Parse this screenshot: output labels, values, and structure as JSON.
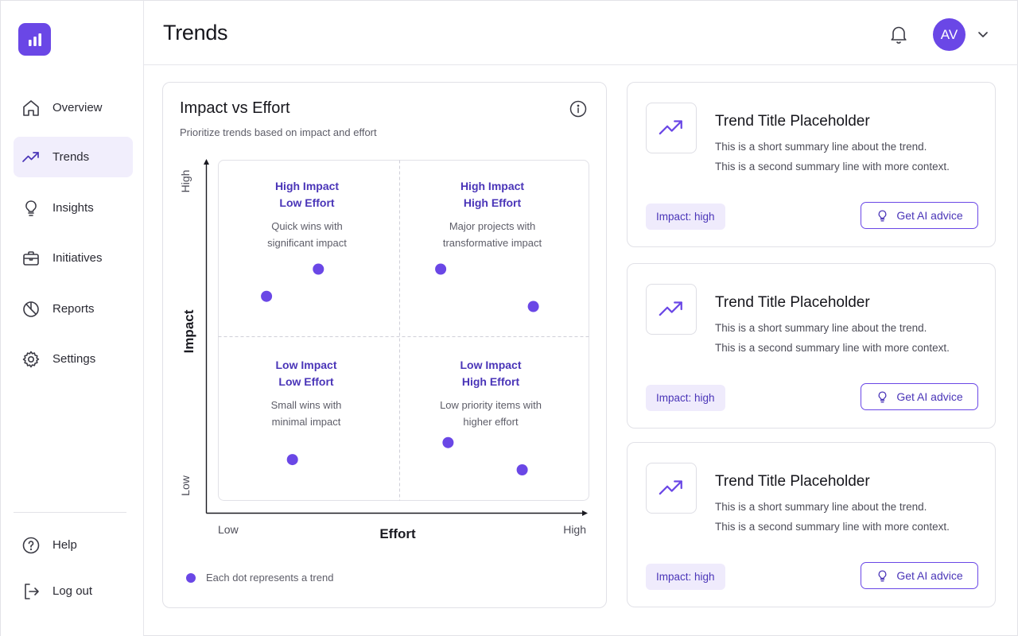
{
  "colors": {
    "accent": "#6a47e6",
    "accent_text": "#4a35b8",
    "active_bg": "#f1eefc"
  },
  "header": {
    "title": "Trends",
    "avatar_initials": "AV"
  },
  "sidebar": {
    "items": [
      {
        "label": "Overview",
        "icon": "home-icon",
        "active": false
      },
      {
        "label": "Trends",
        "icon": "trend-up-icon",
        "active": true
      },
      {
        "label": "Insights",
        "icon": "lightbulb-icon",
        "active": false
      },
      {
        "label": "Initiatives",
        "icon": "briefcase-icon",
        "active": false
      },
      {
        "label": "Reports",
        "icon": "pie-chart-icon",
        "active": false
      },
      {
        "label": "Settings",
        "icon": "gear-icon",
        "active": false
      }
    ],
    "bottom_items": [
      {
        "label": "Help",
        "icon": "help-circle-icon"
      },
      {
        "label": "Log out",
        "icon": "logout-icon"
      }
    ]
  },
  "matrix": {
    "title": "Impact vs Effort",
    "subtitle": "Prioritize trends based on impact and effort",
    "legend": "Each dot represents a trend"
  },
  "chart_data": {
    "type": "scatter",
    "title": "Impact vs Effort",
    "xlabel": "Effort",
    "ylabel": "Impact",
    "x_tick_labels": [
      "Low",
      "High"
    ],
    "y_tick_labels": [
      "Low",
      "High"
    ],
    "xlim": [
      0,
      1
    ],
    "ylim": [
      0,
      1
    ],
    "grid": false,
    "quadrants": [
      {
        "title_line1": "High Impact",
        "title_line2": "Low Effort",
        "desc_line1": "Quick wins with",
        "desc_line2": "significant impact",
        "position": "top-left"
      },
      {
        "title_line1": "High Impact",
        "title_line2": "High Effort",
        "desc_line1": "Major projects with",
        "desc_line2": "transformative impact",
        "position": "top-right"
      },
      {
        "title_line1": "Low Impact",
        "title_line2": "Low Effort",
        "desc_line1": "Small wins with",
        "desc_line2": "minimal impact",
        "position": "bottom-left"
      },
      {
        "title_line1": "Low Impact",
        "title_line2": "High Effort",
        "desc_line1": "Low priority items with",
        "desc_line2": "higher effort",
        "position": "bottom-right"
      }
    ],
    "points": [
      {
        "x": 0.13,
        "y": 0.6
      },
      {
        "x": 0.27,
        "y": 0.68
      },
      {
        "x": 0.6,
        "y": 0.68
      },
      {
        "x": 0.85,
        "y": 0.57
      },
      {
        "x": 0.2,
        "y": 0.12
      },
      {
        "x": 0.62,
        "y": 0.17
      },
      {
        "x": 0.82,
        "y": 0.09
      }
    ]
  },
  "trends": [
    {
      "title": "Trend Title Placeholder",
      "line1": "This is a short summary line about the trend.",
      "line2": "This is a second summary line with more context.",
      "impact": "Impact: high",
      "button": "Get AI advice"
    },
    {
      "title": "Trend Title Placeholder",
      "line1": "This is a short summary line about the trend.",
      "line2": "This is a second summary line with more context.",
      "impact": "Impact: high",
      "button": "Get AI advice"
    },
    {
      "title": "Trend Title Placeholder",
      "line1": "This is a short summary line about the trend.",
      "line2": "This is a second summary line with more context.",
      "impact": "Impact: high",
      "button": "Get AI advice"
    }
  ]
}
